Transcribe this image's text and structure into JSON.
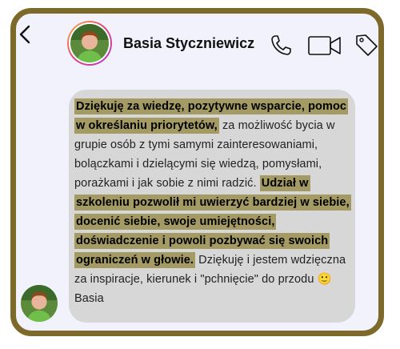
{
  "contact": {
    "name": "Basia Styczniewicz"
  },
  "header_icons": {
    "back": "back-arrow-icon",
    "call": "phone-icon",
    "video": "video-camera-icon",
    "tag": "tag-icon"
  },
  "message": {
    "hl1": "Dziękuję za wiedzę, pozytywne wsparcie, pomoc w określaniu priorytetów,",
    "text1": " za możliwość bycia w grupie osób z tymi samymi zainteresowaniami, bolączkami i dzielącymi się wiedzą, pomysłami, porażkami i jak sobie z nimi radzić. ",
    "hl2": "Udział w szkoleniu pozwolił mi uwierzyć bardziej w siebie, docenić siebie, swoje umiejętności, doświadczenie i powoli pozbywać się swoich ograniczeń w głowie.",
    "text2": " Dziękuję i jestem wdzięczna za inspiracje, kierunek i \"pchnięcie\" do przodu",
    "emoji": "🙂",
    "signature": "Basia"
  },
  "colors": {
    "frame": "#7d6a2a",
    "highlight": "#a49a63",
    "bubble": "#d7d7d7"
  }
}
